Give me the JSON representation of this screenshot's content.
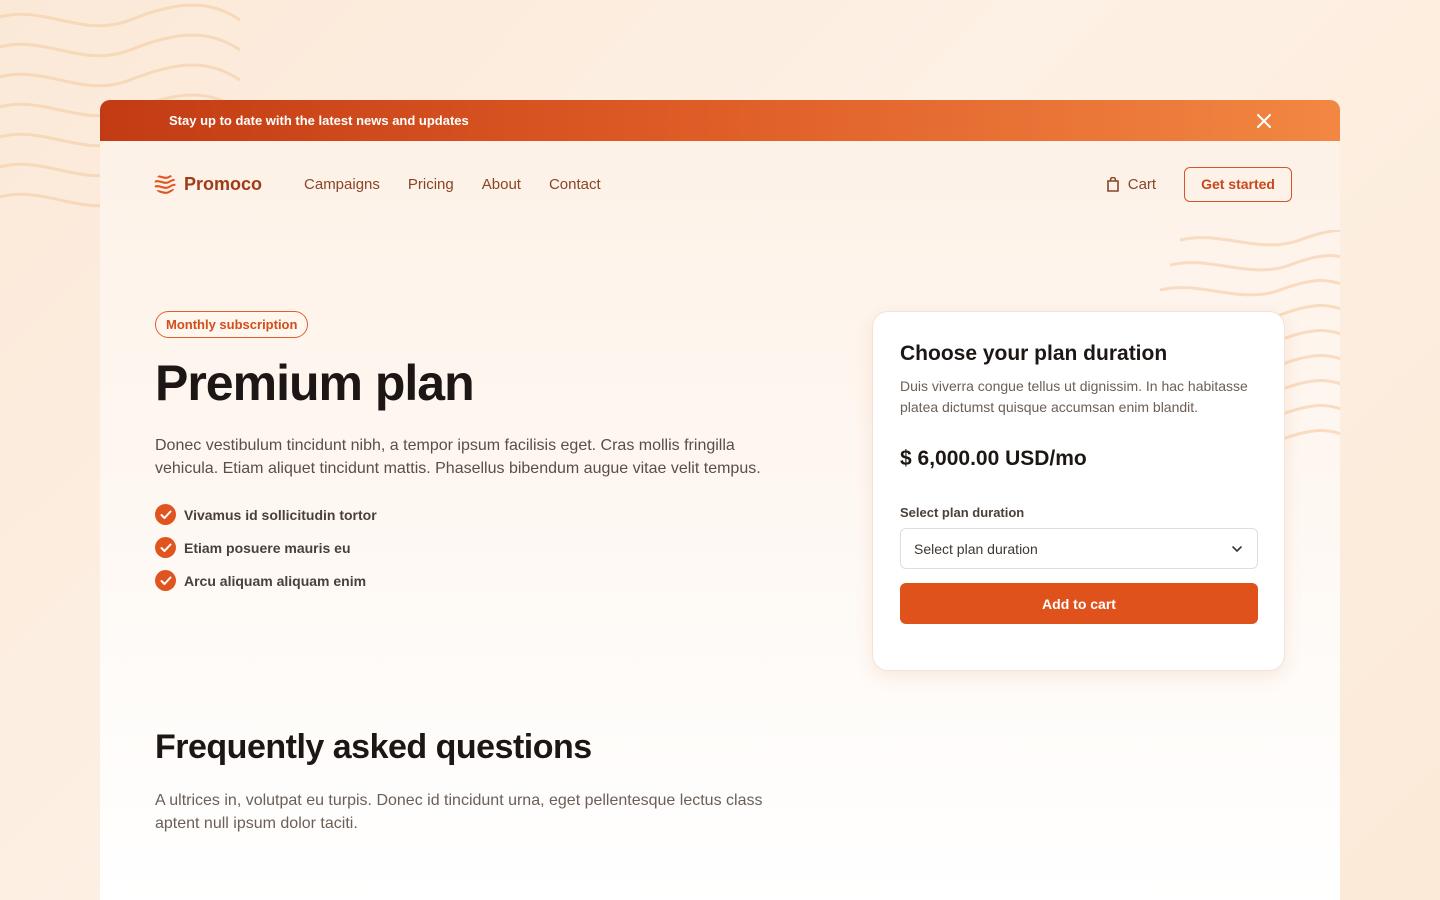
{
  "announcement": {
    "text": "Stay up to date with the latest news and updates"
  },
  "nav": {
    "brand": "Promoco",
    "links": [
      "Campaigns",
      "Pricing",
      "About",
      "Contact"
    ],
    "cart_label": "Cart",
    "cta_label": "Get started"
  },
  "hero": {
    "badge": "Monthly subscription",
    "title": "Premium plan",
    "description": "Donec vestibulum tincidunt nibh, a tempor ipsum facilisis eget. Cras mollis fringilla vehicula. Etiam aliquet tincidunt mattis. Phasellus bibendum augue vitae velit tempus.",
    "features": [
      "Vivamus id sollicitudin tortor",
      "Etiam posuere mauris eu",
      "Arcu aliquam aliquam enim"
    ]
  },
  "card": {
    "title": "Choose your plan duration",
    "description": "Duis viverra congue tellus ut dignissim. In hac habitasse platea dictumst quisque accumsan enim blandit.",
    "price": "$ 6,000.00 USD/mo",
    "select_label": "Select plan duration",
    "select_value": "Select plan duration",
    "button_label": "Add to cart"
  },
  "faq": {
    "title": "Frequently asked questions",
    "description": "A ultrices in, volutpat eu turpis. Donec id tincidunt urna, eget pellentesque lectus class aptent null ipsum dolor taciti."
  },
  "colors": {
    "accent": "#e0521b",
    "brand": "#a03b18",
    "banner_start": "#c23b14",
    "banner_end": "#f28743"
  },
  "icons": [
    "close-icon",
    "logo-icon",
    "shopping-bag-icon",
    "check-icon",
    "chevron-down-icon"
  ]
}
